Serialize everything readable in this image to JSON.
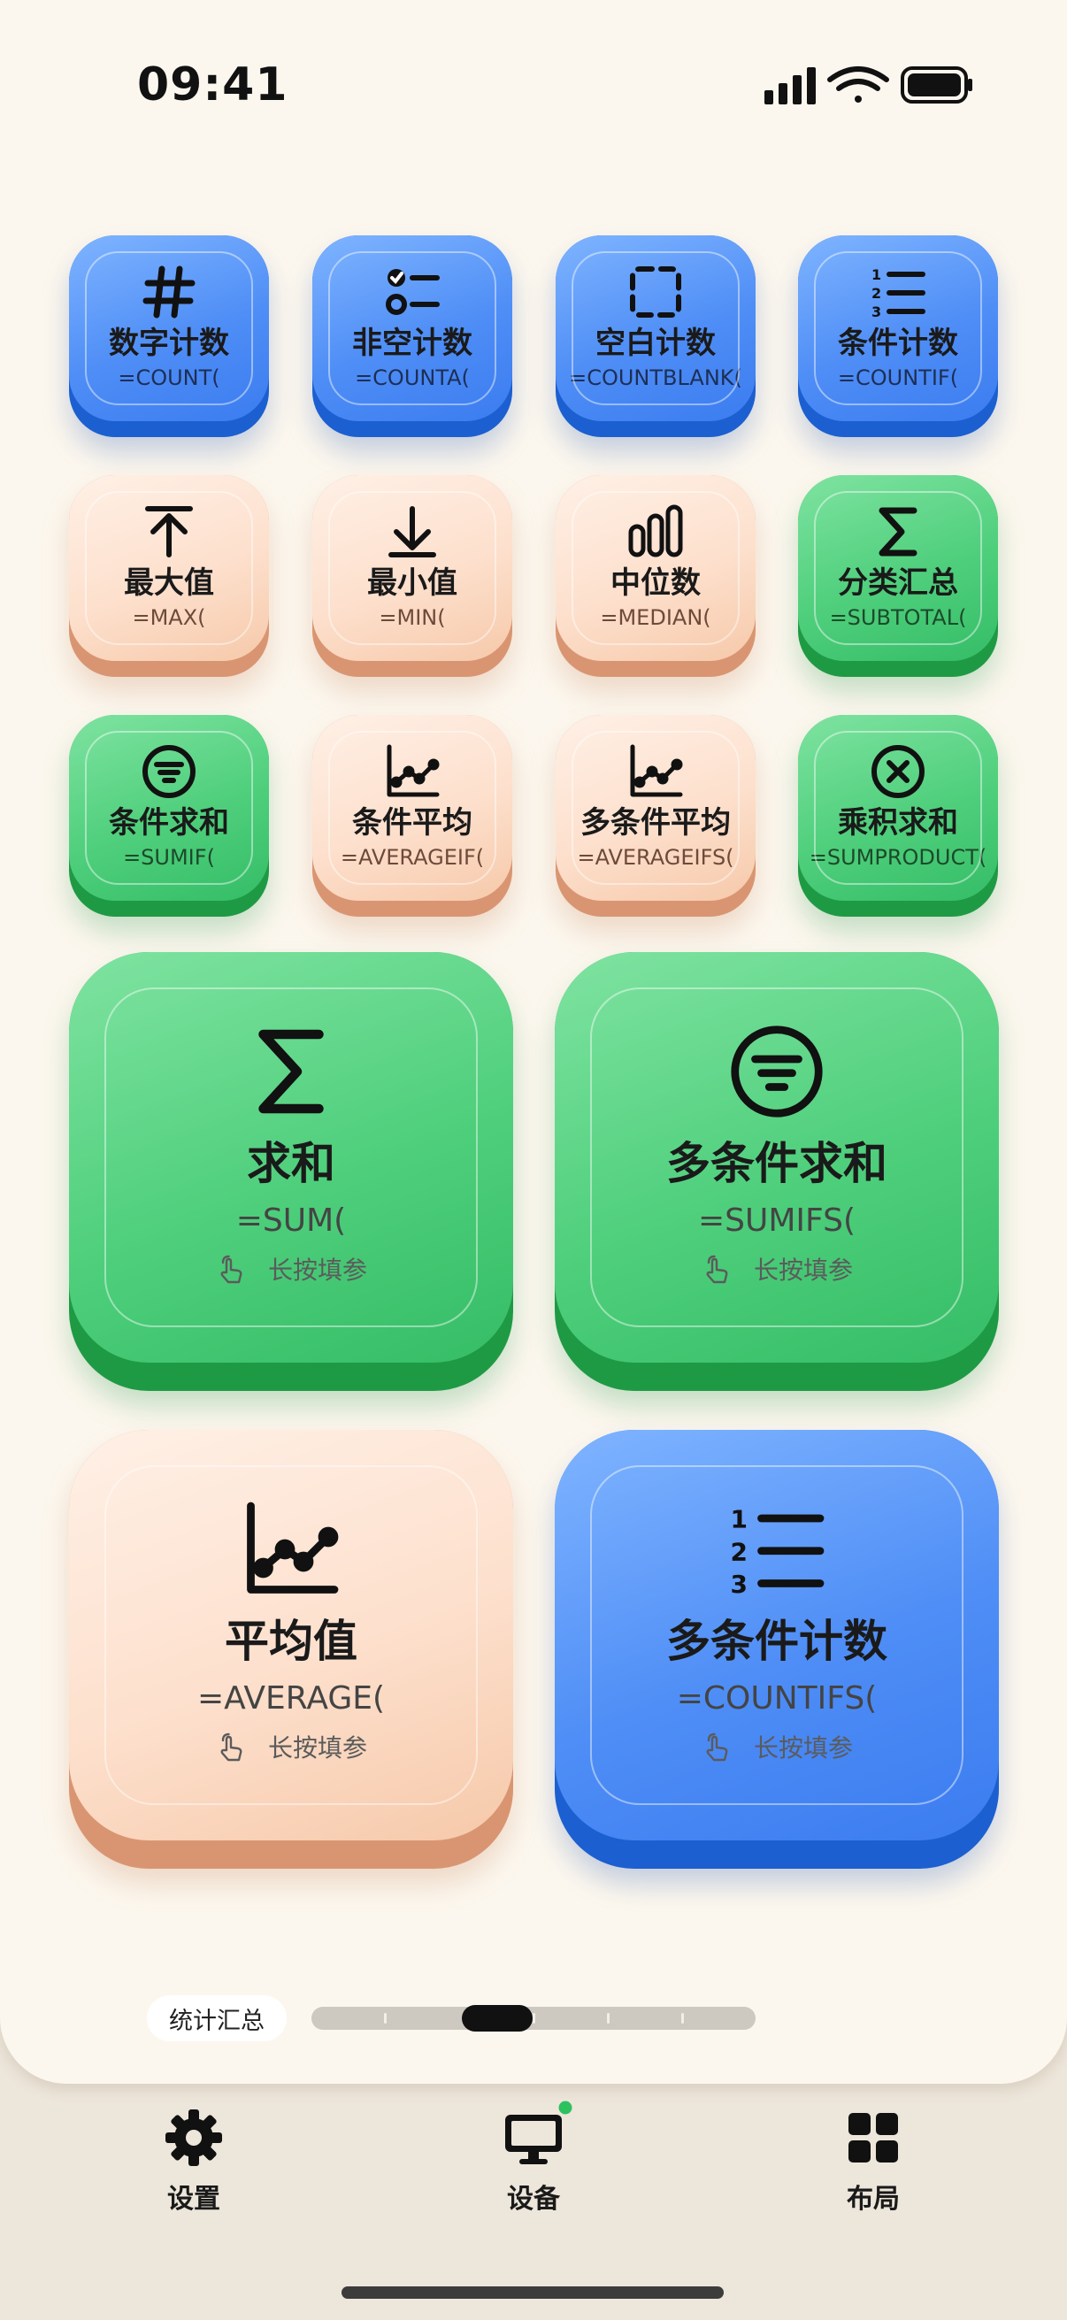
{
  "status_bar": {
    "time": "09:41"
  },
  "colors": {
    "blue": "#4f8ef6",
    "peach": "#fde0cd",
    "green": "#4fcf7c",
    "online_dot": "#2fc15f"
  },
  "keys": [
    {
      "label": "数字计数",
      "formula": "=COUNT(",
      "icon": "hash-icon"
    },
    {
      "label": "非空计数",
      "formula": "=COUNTA(",
      "icon": "checklist-icon"
    },
    {
      "label": "空白计数",
      "formula": "=COUNTBLANK(",
      "icon": "dashed-square-icon"
    },
    {
      "label": "条件计数",
      "formula": "=COUNTIF(",
      "icon": "numbered-list-icon"
    },
    {
      "label": "最大值",
      "formula": "=MAX(",
      "icon": "arrow-up-icon"
    },
    {
      "label": "最小值",
      "formula": "=MIN(",
      "icon": "arrow-down-icon"
    },
    {
      "label": "中位数",
      "formula": "=MEDIAN(",
      "icon": "bars-icon"
    },
    {
      "label": "分类汇总",
      "formula": "=SUBTOTAL(",
      "icon": "sigma-icon"
    },
    {
      "label": "条件求和",
      "formula": "=SUMIF(",
      "icon": "filter-circle-icon"
    },
    {
      "label": "条件平均",
      "formula": "=AVERAGEIF(",
      "icon": "line-chart-icon"
    },
    {
      "label": "多条件平均",
      "formula": "=AVERAGEIFS(",
      "icon": "line-chart-icon"
    },
    {
      "label": "乘积求和",
      "formula": "=SUMPRODUCT(",
      "icon": "multiply-circle-icon"
    }
  ],
  "big_keys": [
    {
      "label": "求和",
      "formula": "=SUM(",
      "hint": "长按填参",
      "icon": "sigma-icon"
    },
    {
      "label": "多条件求和",
      "formula": "=SUMIFS(",
      "hint": "长按填参",
      "icon": "filter-circle-icon"
    },
    {
      "label": "平均值",
      "formula": "=AVERAGE(",
      "hint": "长按填参",
      "icon": "line-chart-icon"
    },
    {
      "label": "多条件计数",
      "formula": "=COUNTIFS(",
      "hint": "长按填参",
      "icon": "numbered-list-icon"
    }
  ],
  "pager": {
    "current_page_label": "统计汇总"
  },
  "tabs": [
    {
      "label": "设置",
      "icon": "gear-icon"
    },
    {
      "label": "设备",
      "icon": "monitor-icon"
    },
    {
      "label": "布局",
      "icon": "grid-icon"
    }
  ]
}
